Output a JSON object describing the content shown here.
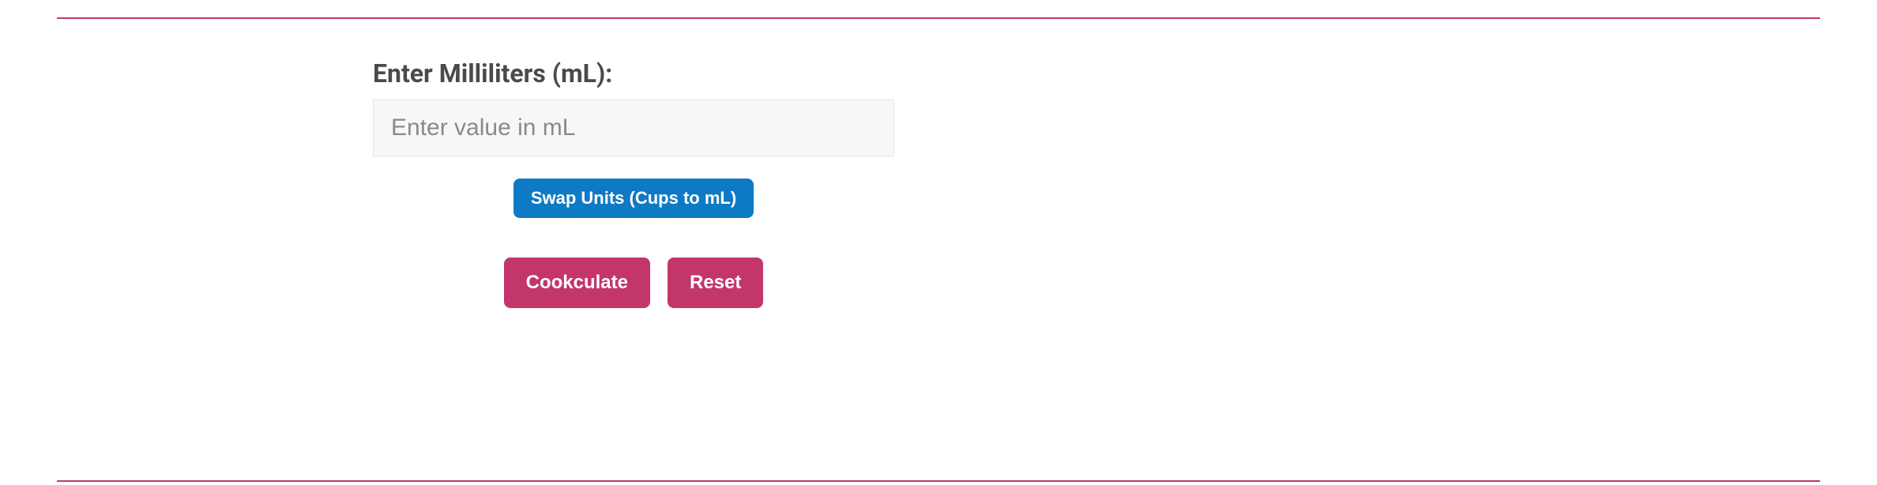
{
  "form": {
    "label": "Enter Milliliters (mL):",
    "input": {
      "value": "",
      "placeholder": "Enter value in mL"
    },
    "swap_label": "Swap Units (Cups to mL)",
    "submit_label": "Cookculate",
    "reset_label": "Reset"
  },
  "colors": {
    "accent": "#c2366b",
    "primary_blue": "#0e7ac4"
  }
}
